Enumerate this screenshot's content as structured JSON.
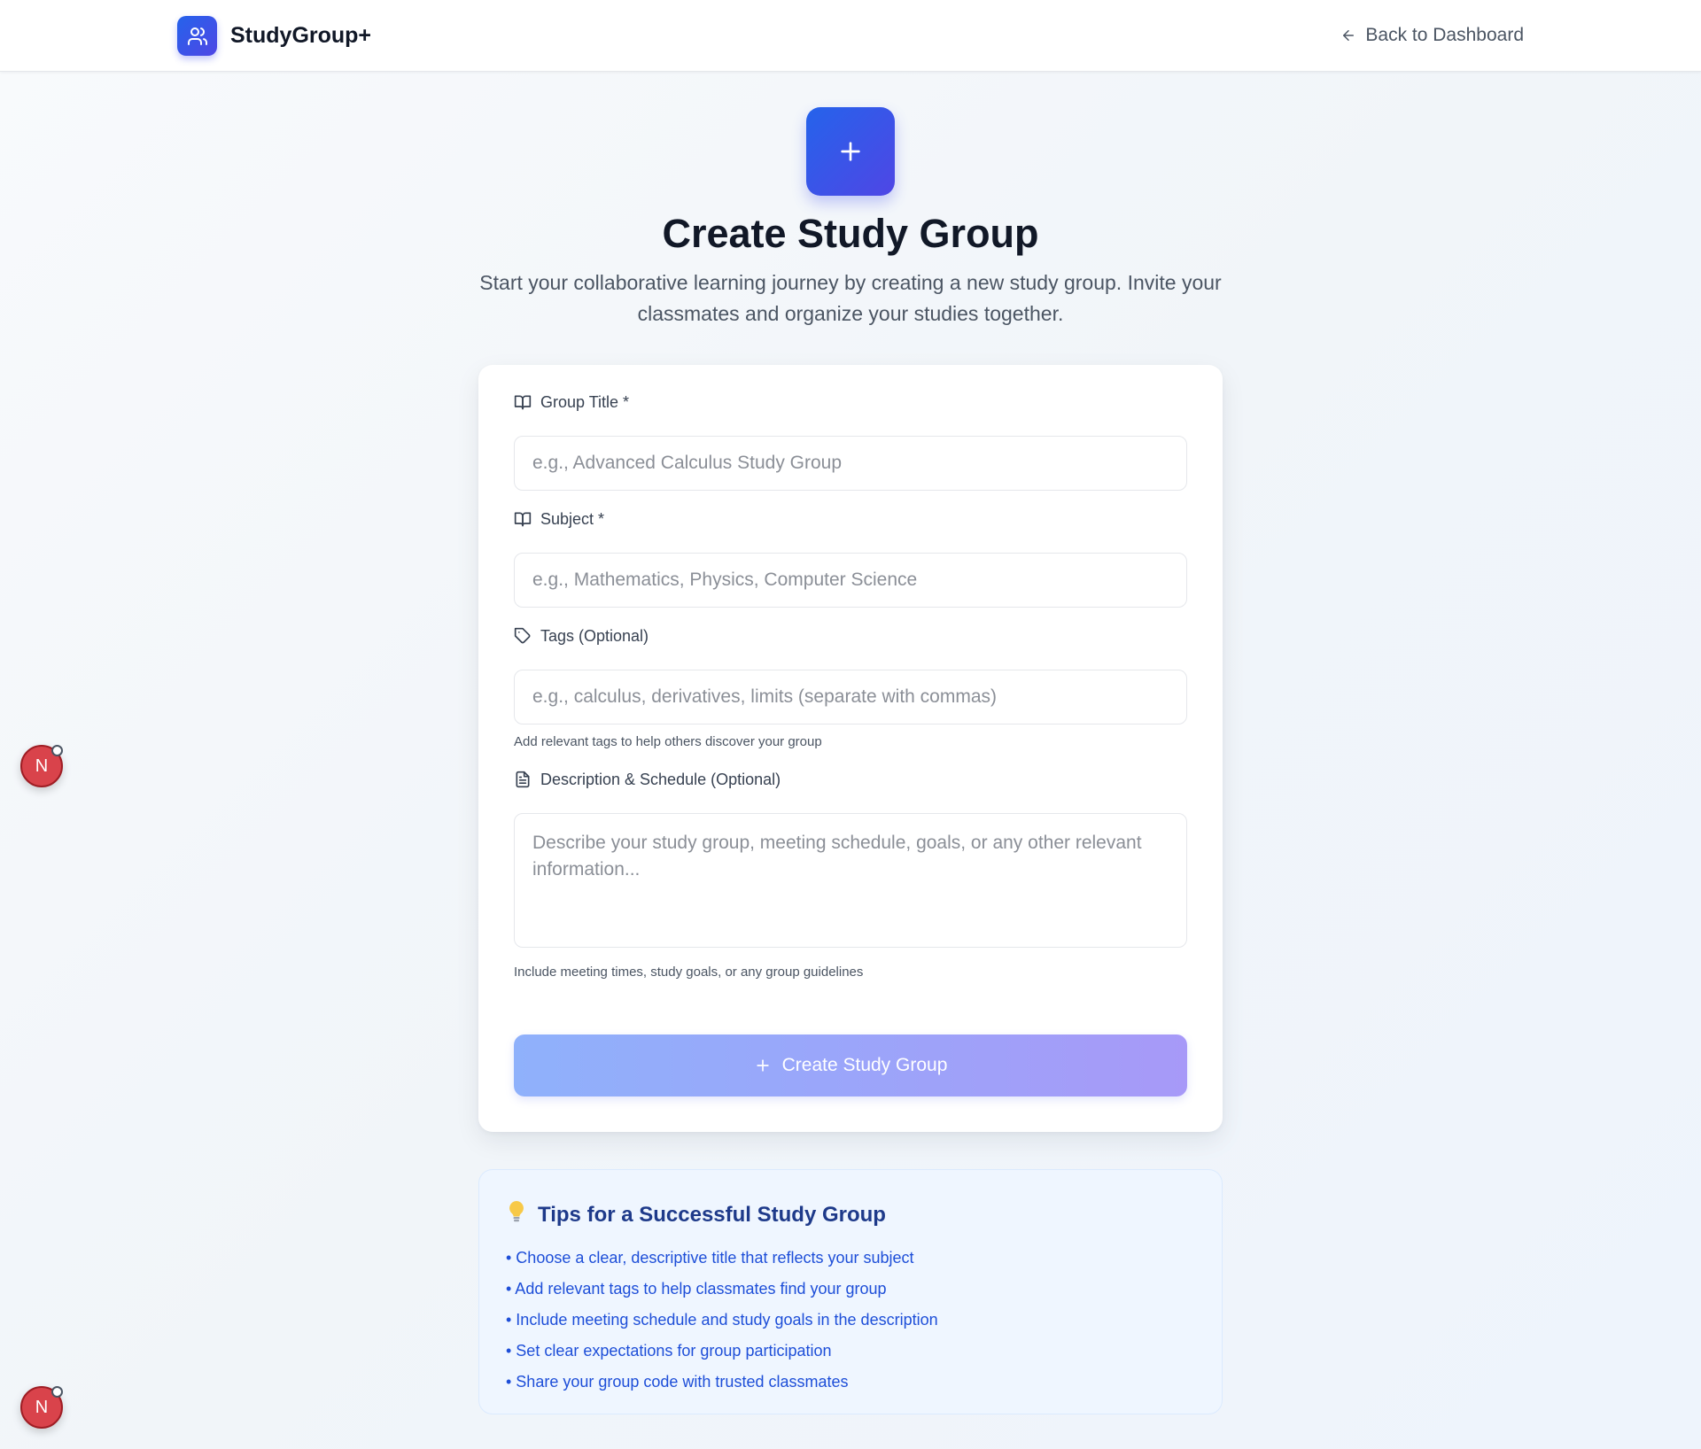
{
  "header": {
    "brand_name": "StudyGroup+",
    "brand_icon": "users-icon",
    "back_label": "Back to Dashboard",
    "back_icon": "arrow-left-icon"
  },
  "hero": {
    "icon": "plus-icon",
    "title": "Create Study Group",
    "subtitle": "Start your collaborative learning journey by creating a new study group. Invite your classmates and organize your studies together."
  },
  "form": {
    "group_title": {
      "label": "Group Title *",
      "icon": "book-open-icon",
      "placeholder": "e.g., Advanced Calculus Study Group",
      "value": ""
    },
    "subject": {
      "label": "Subject *",
      "icon": "book-open-icon",
      "placeholder": "e.g., Mathematics, Physics, Computer Science",
      "value": ""
    },
    "tags": {
      "label": "Tags (Optional)",
      "icon": "tag-icon",
      "placeholder": "e.g., calculus, derivatives, limits (separate with commas)",
      "value": "",
      "hint": "Add relevant tags to help others discover your group"
    },
    "description": {
      "label": "Description & Schedule (Optional)",
      "icon": "file-text-icon",
      "placeholder": "Describe your study group, meeting schedule, goals, or any other relevant information...",
      "value": "",
      "hint": "Include meeting times, study goals, or any group guidelines"
    },
    "submit_label": "Create Study Group",
    "submit_icon": "plus-icon"
  },
  "tips": {
    "icon": "lightbulb-icon",
    "title": "Tips for a Successful Study Group",
    "items": [
      "• Choose a clear, descriptive title that reflects your subject",
      "• Add relevant tags to help classmates find your group",
      "• Include meeting schedule and study goals in the description",
      "• Set clear expectations for group participation",
      "• Share your group code with trusted classmates"
    ]
  },
  "floating_badges": [
    {
      "label": "N"
    },
    {
      "label": "N"
    }
  ],
  "colors": {
    "accent_start": "#2563eb",
    "accent_end": "#4f46e5",
    "button_start": "#8fb1fb",
    "button_end": "#a799f8",
    "tips_background": "#eff6ff",
    "tips_text": "#1d4ed8",
    "badge": "#d9434b"
  }
}
